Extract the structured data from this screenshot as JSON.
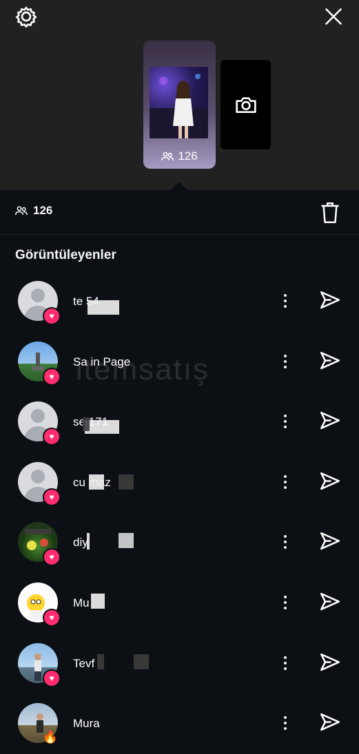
{
  "header": {
    "settings_icon": "gear-icon",
    "close_icon": "close-icon"
  },
  "story": {
    "viewer_count": "126",
    "add_story_icon": "camera-icon"
  },
  "stats": {
    "viewers_count": "126",
    "delete_icon": "trash-icon"
  },
  "section_title": "Görüntüleyenler",
  "watermark": "itemsatış",
  "viewers": [
    {
      "username": "te  54",
      "badge": "heart",
      "avatar": "default"
    },
    {
      "username": "Sa  in Page",
      "badge": "heart",
      "avatar": "landscape"
    },
    {
      "username": "se  171",
      "badge": "heart",
      "avatar": "default"
    },
    {
      "username": "cu  maz",
      "badge": "heart",
      "avatar": "default"
    },
    {
      "username": "diy",
      "badge": "heart",
      "avatar": "game"
    },
    {
      "username": "Mu",
      "badge": "heart",
      "avatar": "cartoon"
    },
    {
      "username": "Tevf",
      "badge": "heart",
      "avatar": "person"
    },
    {
      "username": "Mura",
      "badge": "fire",
      "avatar": "person-outdoor"
    }
  ],
  "colors": {
    "background": "#0c0f14",
    "top_area": "#212121",
    "heart_badge": "#ff2d6f"
  }
}
